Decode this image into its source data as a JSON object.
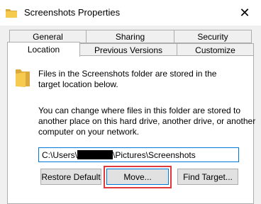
{
  "window": {
    "title": "Screenshots Properties",
    "close_glyph": "✕",
    "icon": "folder-icon"
  },
  "tabs_row1": [
    {
      "label": "General"
    },
    {
      "label": "Sharing"
    },
    {
      "label": "Security"
    }
  ],
  "tabs_row2": [
    {
      "label": "Location",
      "selected": true
    },
    {
      "label": "Previous Versions"
    },
    {
      "label": "Customize"
    }
  ],
  "location": {
    "info_line1": "Files in the Screenshots folder are stored in the",
    "info_line2": "target location below.",
    "desc_line1": "You can change where files in this folder are stored to",
    "desc_line2": "another place on this hard drive, another drive, or another",
    "desc_line3": "computer on your network.",
    "path_prefix": "C:\\Users\\",
    "path_suffix": "\\Pictures\\Screenshots"
  },
  "buttons": {
    "restore_default": "Restore Default",
    "move": "Move...",
    "find_target": "Find Target..."
  },
  "colors": {
    "highlight": "#e0393c",
    "input_focus": "#0078d7",
    "folder": "#f6c94f"
  }
}
